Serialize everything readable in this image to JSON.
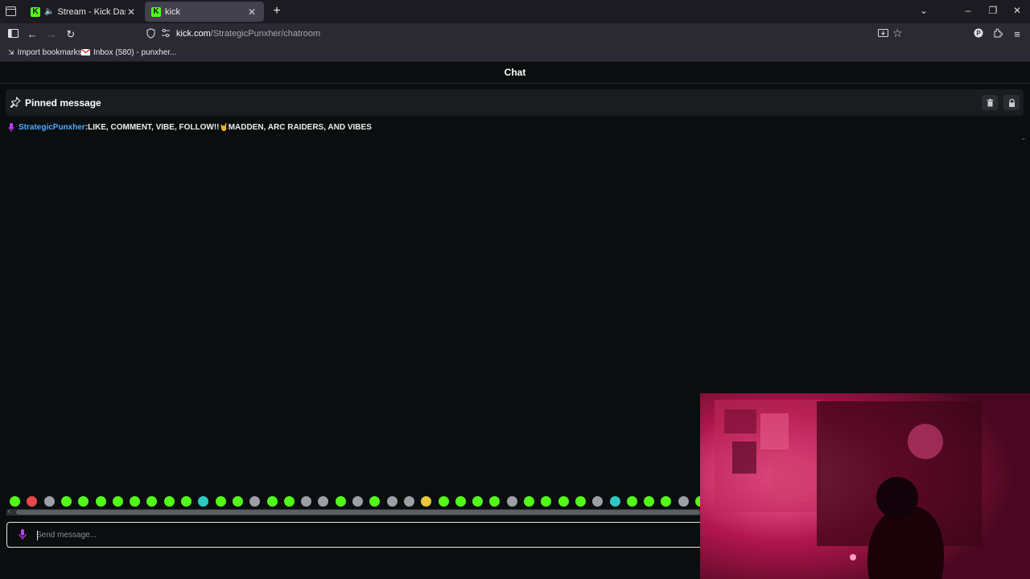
{
  "browser": {
    "tabs": [
      {
        "title": "Stream - Kick Dashboard",
        "favicon": "kick-icon",
        "audio": true
      },
      {
        "title": "kick",
        "favicon": "kick-icon",
        "active": true
      }
    ],
    "url": {
      "host": "kick.com",
      "path": "/StrategicPunxher/chatroom"
    },
    "bookmarks": [
      {
        "label": "Import bookmarks...",
        "icon": "import-icon"
      },
      {
        "label": "Inbox (580) - punxher...",
        "icon": "gmail-icon"
      }
    ]
  },
  "chat": {
    "title": "Chat",
    "pinned": {
      "label": "Pinned message",
      "username": "StrategicPunxher",
      "separator": ":",
      "text_before": " LIKE, COMMENT, VIBE, FOLLOW!!",
      "emoji": "🤘",
      "text_after": "MADDEN, ARC RAIDERS, AND VIBES"
    },
    "composer": {
      "placeholder": "Send message..."
    }
  },
  "colors": {
    "accent": "#53fc18",
    "username": "#4fa7ff",
    "badge": "#c83cff",
    "background": "#0b0e0f"
  }
}
